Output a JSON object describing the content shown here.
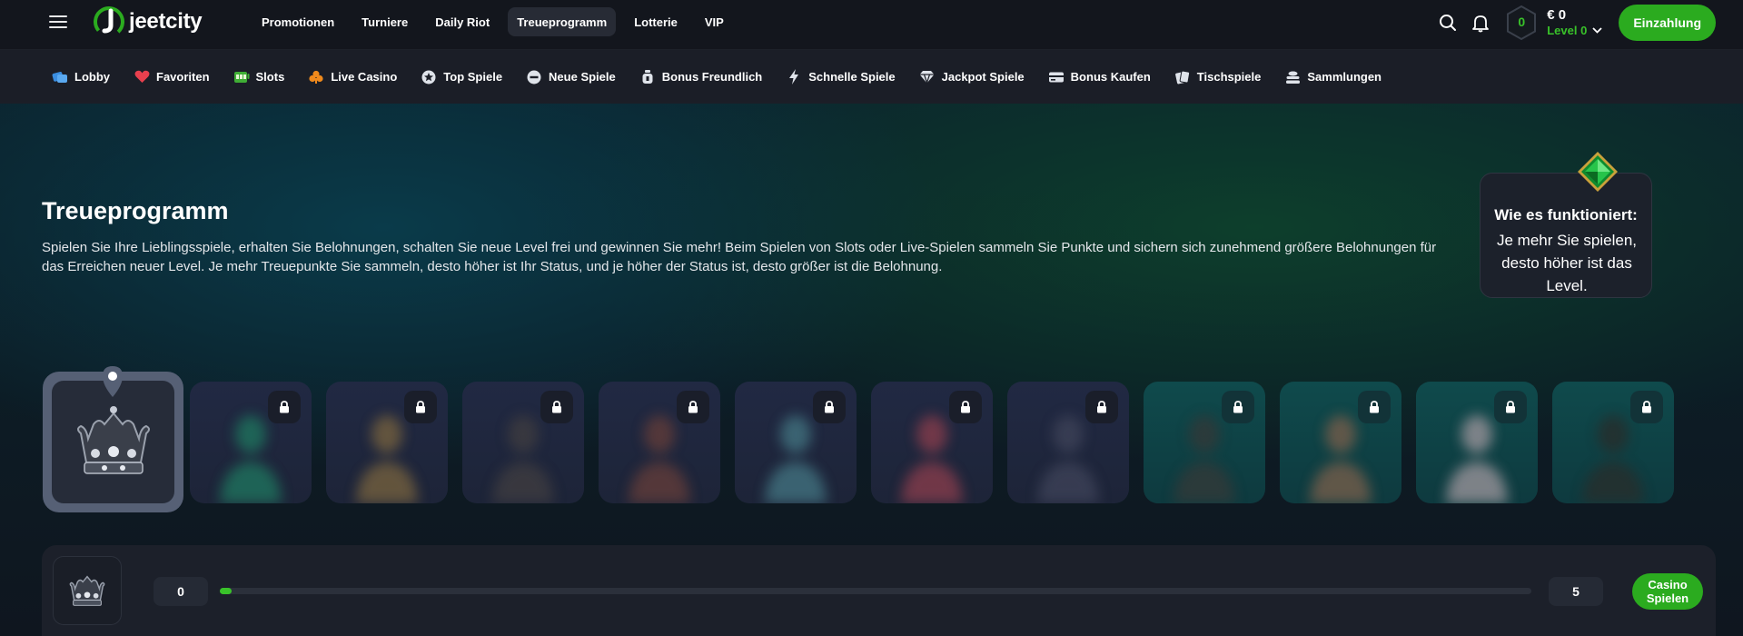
{
  "header": {
    "logo_text": "jeetcity",
    "nav": [
      {
        "label": "Promotionen",
        "active": false
      },
      {
        "label": "Turniere",
        "active": false
      },
      {
        "label": "Daily Riot",
        "active": false
      },
      {
        "label": "Treueprogramm",
        "active": true
      },
      {
        "label": "Lotterie",
        "active": false
      },
      {
        "label": "VIP",
        "active": false
      }
    ],
    "level_badge": "0",
    "balance": "€ 0",
    "level_label": "Level 0",
    "deposit_label": "Einzahlung",
    "icons": [
      "menu-icon",
      "search-icon",
      "bell-icon",
      "chevron-down-icon"
    ]
  },
  "categories": [
    {
      "label": "Lobby",
      "icon": "lobby-icon"
    },
    {
      "label": "Favoriten",
      "icon": "heart-icon"
    },
    {
      "label": "Slots",
      "icon": "slots-icon"
    },
    {
      "label": "Live Casino",
      "icon": "club-icon"
    },
    {
      "label": "Top Spiele",
      "icon": "star-icon"
    },
    {
      "label": "Neue Spiele",
      "icon": "new-icon"
    },
    {
      "label": "Bonus Freundlich",
      "icon": "bonus-icon"
    },
    {
      "label": "Schnelle Spiele",
      "icon": "lightning-icon"
    },
    {
      "label": "Jackpot Spiele",
      "icon": "diamond-icon"
    },
    {
      "label": "Bonus Kaufen",
      "icon": "ticket-icon"
    },
    {
      "label": "Tischspiele",
      "icon": "cards-icon"
    },
    {
      "label": "Sammlungen",
      "icon": "stack-icon"
    }
  ],
  "hero": {
    "title": "Treueprogramm",
    "description": "Spielen Sie Ihre Lieblingsspiele, erhalten Sie Belohnungen, schalten Sie neue Level frei und gewinnen Sie mehr! Beim Spielen von Slots oder Live-Spielen sammeln Sie Punkte und sichern sich zunehmend größere Belohnungen für das Erreichen neuer Level. Je mehr Treuepunkte Sie sammeln, desto höher ist Ihr Status, und je höher der Status ist, desto größer ist die Belohnung.",
    "how_title": "Wie es funktioniert:",
    "how_text": "Je mehr Sie spielen, desto höher ist das Level."
  },
  "levels": {
    "current_icon": "crown-icon",
    "locked": [
      {
        "figure_color": "#1f6b5a",
        "teal": false
      },
      {
        "figure_color": "#6b5a3e",
        "teal": false
      },
      {
        "figure_color": "#3b3a40",
        "teal": false
      },
      {
        "figure_color": "#5a3a3a",
        "teal": false
      },
      {
        "figure_color": "#3e6a78",
        "teal": false
      },
      {
        "figure_color": "#7a3a4a",
        "teal": false
      },
      {
        "figure_color": "#3a3f55",
        "teal": false
      },
      {
        "figure_color": "#2f3a3a",
        "teal": true
      },
      {
        "figure_color": "#6a5a4a",
        "teal": true
      },
      {
        "figure_color": "#8a8a90",
        "teal": true
      },
      {
        "figure_color": "#25302f",
        "teal": true
      }
    ]
  },
  "progress": {
    "start": "0",
    "end": "5",
    "fraction": 0.009,
    "play_label": "Casino\nSpielen"
  },
  "colors": {
    "accent_green": "#2bab1f",
    "level_green": "#39c22a"
  }
}
